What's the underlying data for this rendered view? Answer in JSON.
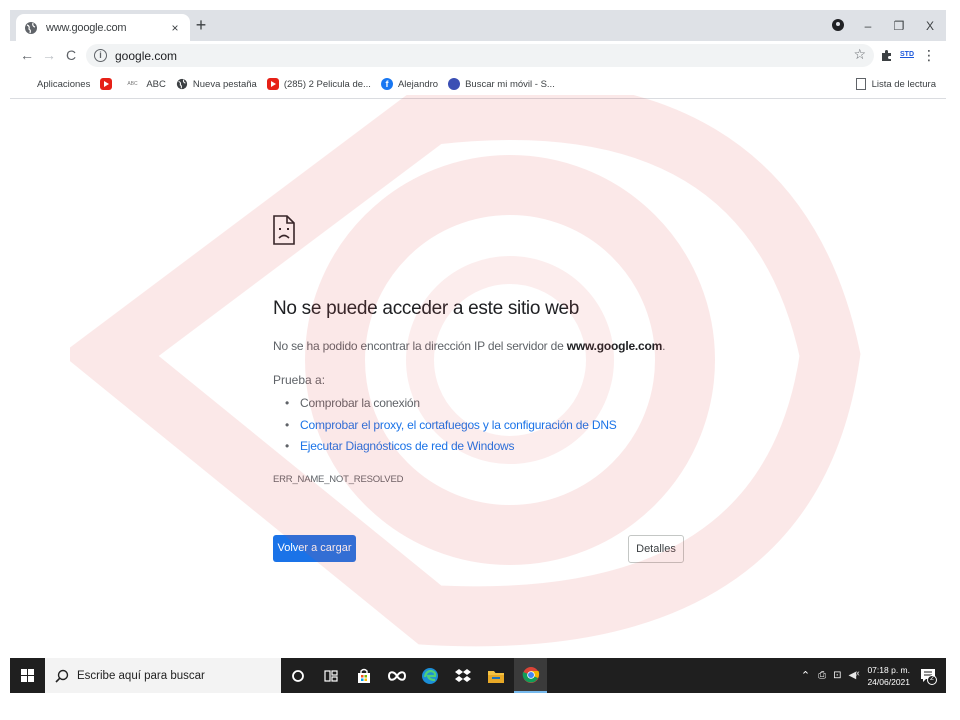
{
  "tab": {
    "title": "www.google.com",
    "close": "×"
  },
  "window": {
    "new_tab": "+",
    "minimize": "–",
    "restore": "❐",
    "close": "X"
  },
  "omnibox": {
    "url": "google.com"
  },
  "toolbar": {
    "extension_label": "STD"
  },
  "bookmarks": [
    {
      "label": "Aplicaciones",
      "icon": "apps-grid-icon"
    },
    {
      "label": "",
      "icon": "youtube-icon"
    },
    {
      "label": "ABC",
      "icon": "abc-icon",
      "icon_text": "ABC"
    },
    {
      "label": "Nueva pestaña",
      "icon": "globe-icon"
    },
    {
      "label": "(285) 2 Pelicula de...",
      "icon": "youtube-icon"
    },
    {
      "label": "Alejandro",
      "icon": "facebook-icon",
      "icon_text": "f"
    },
    {
      "label": "Buscar mi móvil - S...",
      "icon": "find-my-mobile-icon"
    }
  ],
  "reading_list": "Lista de lectura",
  "error": {
    "title": "No se puede acceder a este sitio web",
    "desc_prefix": "No se ha podido encontrar la dirección IP del servidor de ",
    "desc_host": "www.google.com",
    "desc_suffix": ".",
    "try_label": "Prueba a:",
    "suggestions": [
      "Comprobar la conexión",
      "Comprobar el proxy, el cortafuegos y la configuración de DNS",
      "Ejecutar Diagnósticos de red de Windows"
    ],
    "code": "ERR_NAME_NOT_RESOLVED",
    "reload_label": "Volver a cargar",
    "details_label": "Detalles"
  },
  "taskbar": {
    "search_placeholder": "Escribe aquí para buscar",
    "time": "07:18 p. m.",
    "date": "24/06/2021",
    "notification_count": "2"
  },
  "colors": {
    "link": "#1a73e8",
    "button_primary": "#1a73e8",
    "watermark": "#f2c4c4"
  }
}
